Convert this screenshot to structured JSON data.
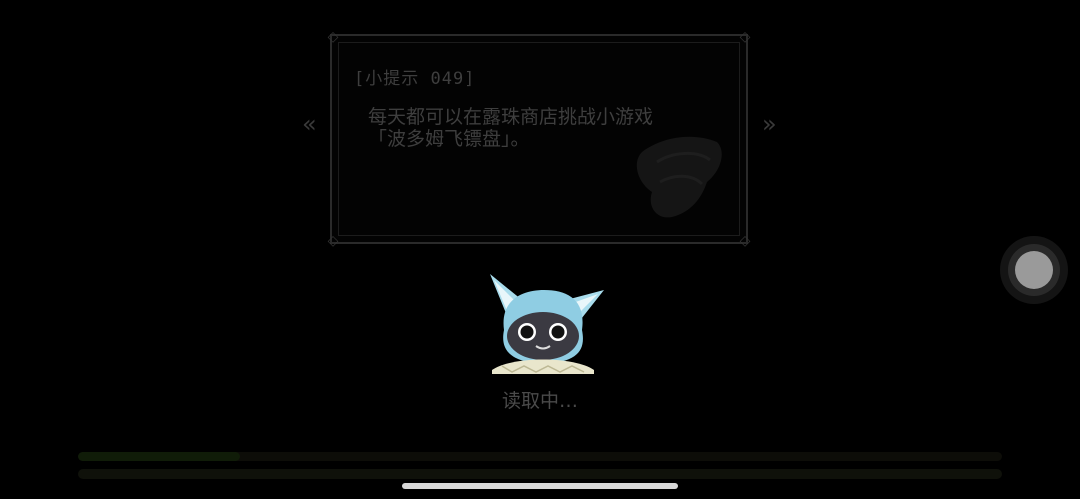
{
  "tip": {
    "title": "[小提示 049]",
    "line1": "每天都可以在露珠商店挑战小游戏",
    "line2": "「波多姆飞镖盘」。"
  },
  "nav": {
    "prev_icon": "chevron-left-icon",
    "next_icon": "chevron-right-icon",
    "prev_glyph": "«",
    "next_glyph": "»"
  },
  "loading": {
    "text": "读取中…",
    "progress": 0.175
  },
  "colors": {
    "background": "#000000",
    "panel_border": "#2a2a2a",
    "tip_text": "#3e3e3e",
    "mascot_fur": "#9fd8ea",
    "progress_fill": "#101c08"
  },
  "icons": {
    "assistive_touch": "assistive-touch-icon",
    "corner": "ornament-corner-icon",
    "home_indicator": "home-indicator"
  }
}
